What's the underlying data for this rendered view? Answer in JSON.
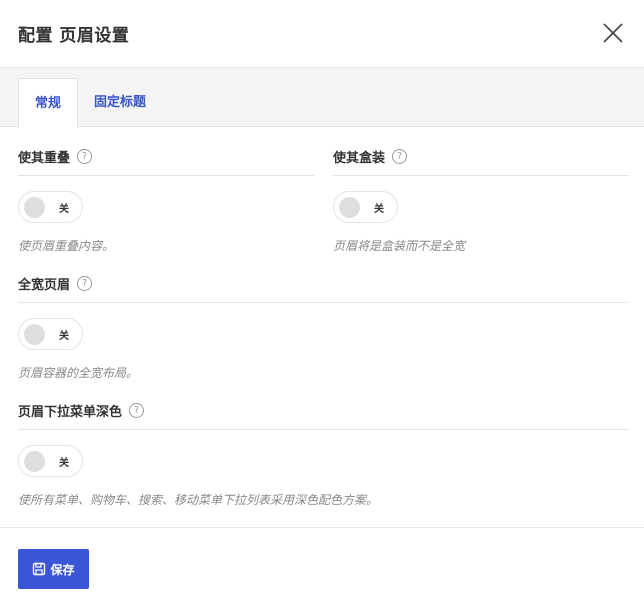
{
  "dialog": {
    "title": "配置 页眉设置",
    "close_icon": "close-icon"
  },
  "tabs": [
    {
      "label": "常规",
      "active": true
    },
    {
      "label": "固定标题",
      "active": false
    }
  ],
  "settings": [
    {
      "label": "使其重叠",
      "help": "?",
      "toggle_state": "关",
      "description": "使页眉重叠内容。"
    },
    {
      "label": "使其盒装",
      "help": "?",
      "toggle_state": "关",
      "description": "页眉将是盒装而不是全宽"
    },
    {
      "label": "全宽页眉",
      "help": "?",
      "toggle_state": "关",
      "description": "页眉容器的全宽布局。"
    },
    {
      "label": "页眉下拉菜单深色",
      "help": "?",
      "toggle_state": "关",
      "description": "使所有菜单、购物车、搜索、移动菜单下拉列表采用深色配色方案。"
    }
  ],
  "footer": {
    "save_label": "保存",
    "save_icon": "save-icon"
  },
  "colors": {
    "accent": "#3a55d6",
    "tab_text": "#3755c8"
  }
}
